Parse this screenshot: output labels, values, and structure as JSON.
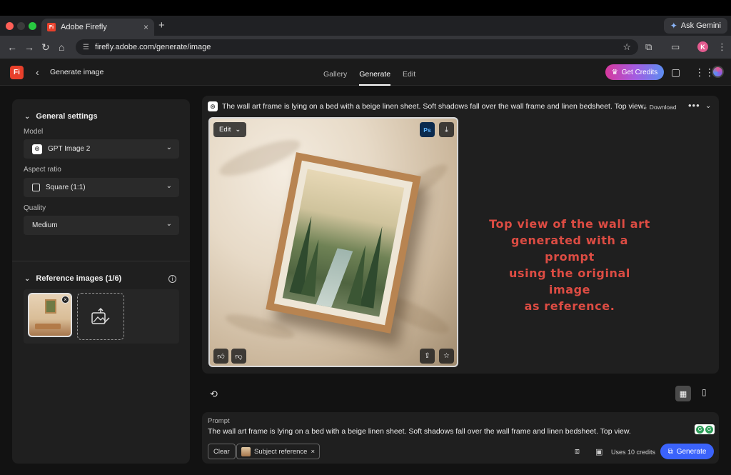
{
  "browser": {
    "tab_title": "Adobe Firefly",
    "new_tab": "+",
    "ask_gemini": "Ask Gemini",
    "url": "firefly.adobe.com/generate/image",
    "profile_initial": "K"
  },
  "header": {
    "logo": "Fi",
    "title": "Generate image",
    "tabs": [
      {
        "label": "Gallery",
        "active": false
      },
      {
        "label": "Generate",
        "active": true
      },
      {
        "label": "Edit",
        "active": false
      }
    ],
    "get_credits": "Get Credits"
  },
  "sidebar": {
    "general_settings": "General settings",
    "model_label": "Model",
    "model_value": "GPT Image 2",
    "aspect_label": "Aspect ratio",
    "aspect_value": "Square (1:1)",
    "quality_label": "Quality",
    "quality_value": "Medium",
    "reference_images": "Reference images (1/6)"
  },
  "result": {
    "prompt": "The wall art frame is lying on a bed with a beige linen sheet. Soft shadows fall over the wall frame and linen bedsheet. Top view.",
    "download": "Download",
    "edit_label": "Edit",
    "ps_label": "Ps"
  },
  "annotation": {
    "line1": "Top view of the wall art",
    "line2": "generated with a prompt",
    "line3": "using the original image",
    "line4": "as reference."
  },
  "prompt_panel": {
    "label": "Prompt",
    "text": "The wall art frame is lying on a bed with a beige linen sheet. Soft shadows fall over the wall frame and linen bedsheet. Top view.",
    "clear": "Clear",
    "chip": "Subject reference",
    "chip_close": "×",
    "uses": "Uses 10 credits",
    "generate": "Generate"
  },
  "colors": {
    "accent_blue": "#3b63fb",
    "brand_red": "#e8402b",
    "annotation_red": "#dd4c43"
  },
  "icons": [
    "back-icon",
    "forward-icon",
    "reload-icon",
    "home-icon",
    "star-icon",
    "extensions-icon",
    "feedback-icon",
    "apps-grid-icon",
    "download-icon",
    "more-icon",
    "thumbs-up-icon",
    "thumbs-down-icon",
    "share-icon",
    "favorite-icon",
    "history-icon",
    "grid-view-icon",
    "single-view-icon",
    "add-image-icon"
  ]
}
